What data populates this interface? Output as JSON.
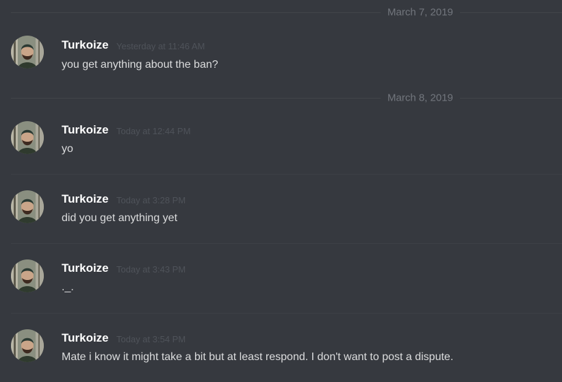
{
  "dividers": [
    {
      "label": "March 7, 2019"
    },
    {
      "label": "March 8, 2019"
    }
  ],
  "messages": [
    {
      "author": "Turkoize",
      "timestamp": "Yesterday at 11:46 AM",
      "content": "you get anything about the ban?",
      "avatar_icon": "user-avatar-photo"
    },
    {
      "author": "Turkoize",
      "timestamp": "Today at 12:44 PM",
      "content": "yo",
      "avatar_icon": "user-avatar-photo"
    },
    {
      "author": "Turkoize",
      "timestamp": "Today at 3:28 PM",
      "content": "did you get anything yet",
      "avatar_icon": "user-avatar-photo"
    },
    {
      "author": "Turkoize",
      "timestamp": "Today at 3:43 PM",
      "content": "._.",
      "avatar_icon": "user-avatar-photo"
    },
    {
      "author": "Turkoize",
      "timestamp": "Today at 3:54 PM",
      "content": "Mate i know it might take a bit but at least respond. I don't want to post a dispute.",
      "avatar_icon": "user-avatar-photo"
    }
  ],
  "colors": {
    "background": "#36393f",
    "username": "#ffffff",
    "timestamp": "#4f535a",
    "message_text": "#dcddde",
    "divider_text": "#72767d"
  }
}
